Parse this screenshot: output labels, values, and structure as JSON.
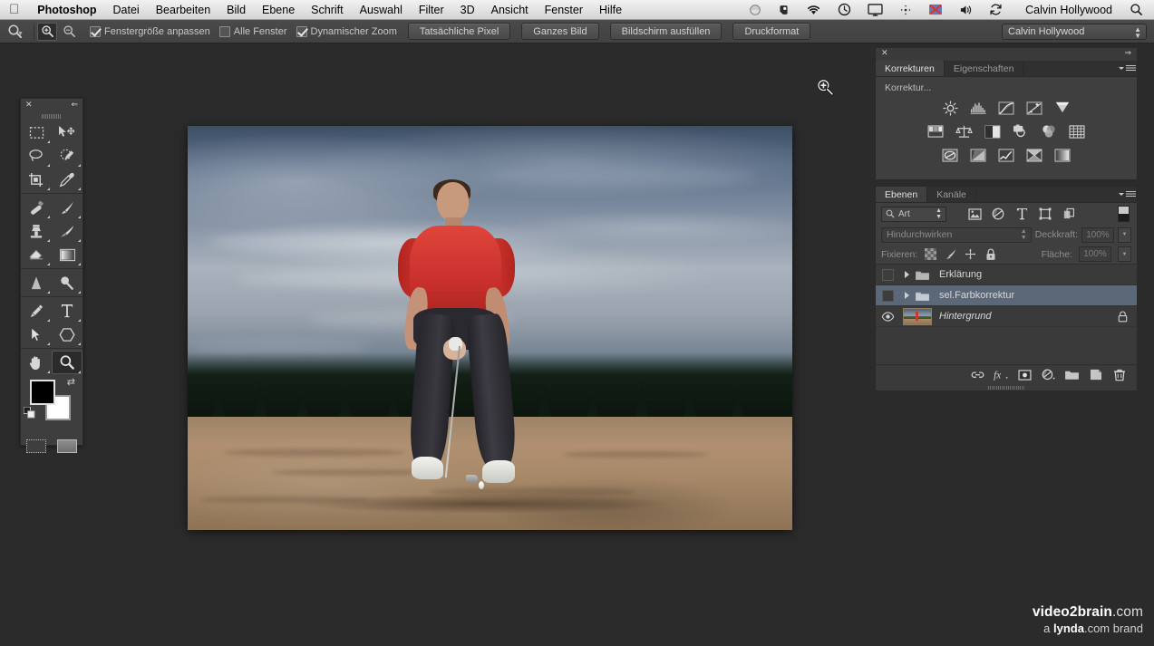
{
  "menubar": {
    "apple_icon": "apple-logo-icon",
    "items": [
      "Photoshop",
      "Datei",
      "Bearbeiten",
      "Bild",
      "Ebene",
      "Schrift",
      "Auswahl",
      "Filter",
      "3D",
      "Ansicht",
      "Fenster",
      "Hilfe"
    ],
    "status_icons": [
      "dropbox-icon",
      "evernote-icon",
      "wifi-icon",
      "timemachine-icon",
      "display-icon",
      "teamviewer-icon",
      "displaylink-icon",
      "volume-icon",
      "sync-icon"
    ],
    "user_name": "Calvin Hollywood",
    "search_icon": "spotlight-search-icon"
  },
  "options_bar": {
    "tool_icon": "zoom-tool-icon",
    "zoom_in_icon": "zoom-in-icon",
    "zoom_out_icon": "zoom-out-icon",
    "checkboxes": [
      {
        "label": "Fenstergröße anpassen",
        "checked": true
      },
      {
        "label": "Alle Fenster",
        "checked": false
      },
      {
        "label": "Dynamischer Zoom",
        "checked": true
      }
    ],
    "buttons": [
      "Tatsächliche Pixel",
      "Ganzes Bild",
      "Bildschirm ausfüllen",
      "Druckformat"
    ],
    "workspace": "Calvin Hollywood"
  },
  "toolbar": {
    "close_icon": "close-icon",
    "collapse_icon": "double-chevron-left-icon",
    "tools": [
      {
        "name": "rectangular-marquee-tool",
        "has_flyout": true
      },
      {
        "name": "move-tool",
        "has_flyout": false
      },
      {
        "name": "lasso-tool",
        "has_flyout": true
      },
      {
        "name": "quick-selection-tool",
        "has_flyout": true
      },
      {
        "name": "crop-tool",
        "has_flyout": true
      },
      {
        "name": "eyedropper-tool",
        "has_flyout": true
      },
      {
        "name": "spot-healing-brush-tool",
        "has_flyout": true
      },
      {
        "name": "brush-tool",
        "has_flyout": true
      },
      {
        "name": "clone-stamp-tool",
        "has_flyout": true
      },
      {
        "name": "history-brush-tool",
        "has_flyout": true
      },
      {
        "name": "eraser-tool",
        "has_flyout": true
      },
      {
        "name": "gradient-tool",
        "has_flyout": true
      },
      {
        "name": "blur-tool",
        "has_flyout": true
      },
      {
        "name": "dodge-tool",
        "has_flyout": true
      },
      {
        "name": "pen-tool",
        "has_flyout": true
      },
      {
        "name": "type-tool",
        "has_flyout": true
      },
      {
        "name": "path-selection-tool",
        "has_flyout": true
      },
      {
        "name": "shape-tool",
        "has_flyout": true
      },
      {
        "name": "hand-tool",
        "has_flyout": true
      },
      {
        "name": "zoom-tool",
        "has_flyout": true,
        "selected": true
      }
    ],
    "foreground_color": "#000000",
    "background_color": "#ffffff",
    "swap_icon": "swap-colors-icon",
    "default_icon": "default-colors-icon",
    "quickmask_icon": "quick-mask-mode-icon",
    "screenmode_icon": "screen-mode-icon"
  },
  "document": {
    "image_alt": "golfer in sand bunker",
    "cursor_icon": "zoom-in-cursor-icon"
  },
  "panels": {
    "adjustments": {
      "close_icon": "close-icon",
      "collapse_icon": "double-chevron-right-icon",
      "menu_icon": "panel-menu-icon",
      "tabs": [
        {
          "label": "Korrekturen",
          "active": true
        },
        {
          "label": "Eigenschaften",
          "active": false
        }
      ],
      "section_label": "Korrektur...",
      "rows": [
        [
          "brightness-contrast-icon",
          "levels-icon",
          "curves-icon",
          "exposure-icon",
          "vibrance-icon"
        ],
        [
          "hue-saturation-icon",
          "color-balance-icon",
          "black-white-icon",
          "photo-filter-icon",
          "channel-mixer-icon",
          "color-lookup-icon"
        ],
        [
          "invert-icon",
          "posterize-icon",
          "threshold-icon",
          "selective-color-icon",
          "gradient-map-icon"
        ]
      ]
    },
    "layers": {
      "menu_icon": "panel-menu-icon",
      "tabs": [
        {
          "label": "Ebenen",
          "active": true
        },
        {
          "label": "Kanäle",
          "active": false
        }
      ],
      "filter": {
        "search_icon": "search-icon",
        "type_label": "Art",
        "filter_icons": [
          "pixel-layer-filter-icon",
          "adjustment-layer-filter-icon",
          "type-layer-filter-icon",
          "shape-layer-filter-icon",
          "smart-object-filter-icon"
        ],
        "toggle_icon": "filter-toggle-icon"
      },
      "blend_mode": "Hindurchwirken",
      "opacity_label": "Deckkraft:",
      "opacity_value": "100%",
      "lock_label": "Fixieren:",
      "lock_icons": [
        "lock-transparency-icon",
        "lock-image-icon",
        "lock-position-icon",
        "lock-all-icon"
      ],
      "fill_label": "Fläche:",
      "fill_value": "100%",
      "items": [
        {
          "name": "Erklärung",
          "type": "group",
          "visible": false,
          "selected": false,
          "locked": false,
          "expanded": false
        },
        {
          "name": "sel.Farbkorrektur",
          "type": "group",
          "visible": false,
          "selected": true,
          "locked": false,
          "expanded": false
        },
        {
          "name": "Hintergrund",
          "type": "image",
          "visible": true,
          "selected": false,
          "locked": true,
          "italic": true
        }
      ],
      "footer_icons": [
        "link-layers-icon",
        "layer-style-fx-icon",
        "layer-mask-icon",
        "new-adjustment-layer-icon",
        "new-group-icon",
        "new-layer-icon",
        "delete-layer-icon"
      ]
    }
  },
  "watermark": {
    "line1_bold": "video2brain",
    "line1_light": ".com",
    "line2_pre": "a ",
    "line2_bold": "lynda",
    "line2_post": ".com brand"
  },
  "colors": {
    "app_bg": "#2b2b2b",
    "panel_bg": "#3f3f3f",
    "panel_header": "#303030",
    "selection_blue": "#5a6878",
    "options_bar": "#454545",
    "accent_red": "#c9302c"
  }
}
